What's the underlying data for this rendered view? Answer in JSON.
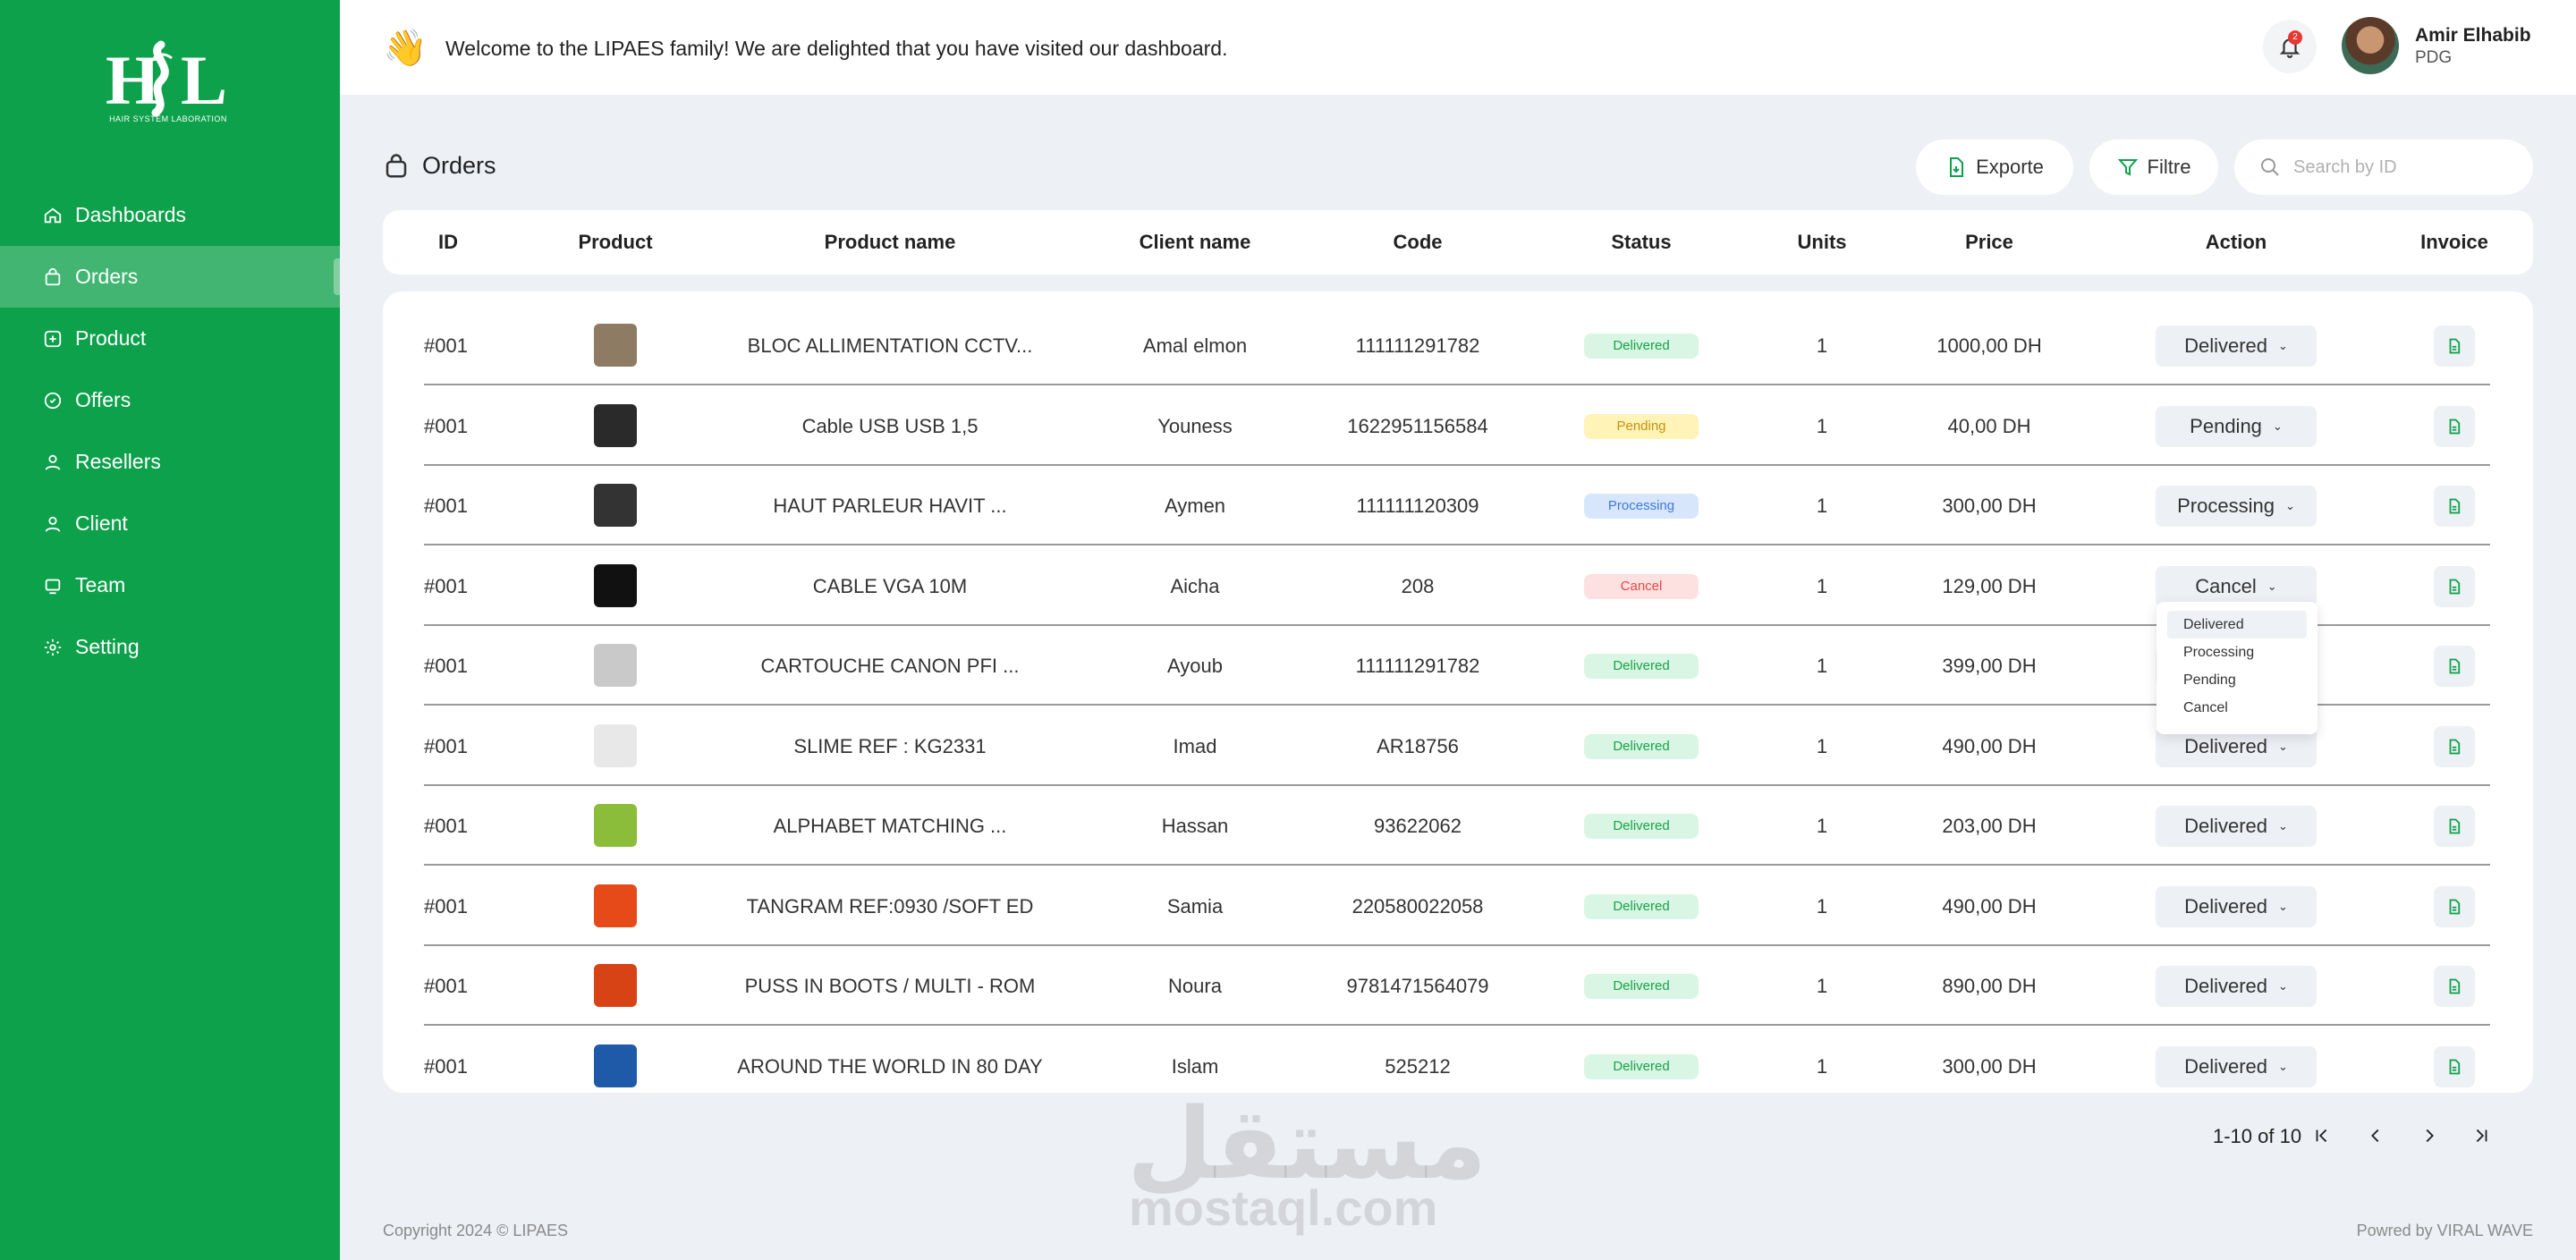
{
  "sidebar": {
    "logo_text": "HSL",
    "logo_subtitle": "HAIR SYSTEM LABORATION",
    "items": [
      {
        "label": "Dashboards",
        "icon": "home-icon"
      },
      {
        "label": "Orders",
        "icon": "bag-icon",
        "active": true
      },
      {
        "label": "Product",
        "icon": "plus-box-icon"
      },
      {
        "label": "Offers",
        "icon": "offer-icon"
      },
      {
        "label": "Resellers",
        "icon": "user-icon"
      },
      {
        "label": "Client",
        "icon": "user-icon"
      },
      {
        "label": "Team",
        "icon": "team-icon"
      },
      {
        "label": "Setting",
        "icon": "gear-icon"
      }
    ]
  },
  "topbar": {
    "welcome": "Welcome to the LIPAES family! We are delighted that you have visited our dashboard.",
    "wave_emoji": "👋",
    "notifications_count": "2",
    "user_name": "Amir Elhabib",
    "user_role": "PDG"
  },
  "page": {
    "title": "Orders",
    "export_label": "Exporte",
    "filter_label": "Filtre",
    "search_placeholder": "Search by ID"
  },
  "table": {
    "headers": [
      "ID",
      "Product",
      "Product name",
      "Client name",
      "Code",
      "Status",
      "Units",
      "Price",
      "Action",
      "Invoice"
    ],
    "rows": [
      {
        "id": "#001",
        "product_name": "BLOC ALLIMENTATION CCTV...",
        "client": "Amal elmon",
        "code": "111111291782",
        "status": "Delivered",
        "units": "1",
        "price": "1000,00 DH",
        "action": "Delivered"
      },
      {
        "id": "#001",
        "product_name": "Cable USB USB 1,5",
        "client": "Youness",
        "code": "1622951156584",
        "status": "Pending",
        "units": "1",
        "price": "40,00 DH",
        "action": "Pending"
      },
      {
        "id": "#001",
        "product_name": "HAUT PARLEUR HAVIT ...",
        "client": "Aymen",
        "code": "111111120309",
        "status": "Processing",
        "units": "1",
        "price": "300,00 DH",
        "action": "Processing"
      },
      {
        "id": "#001",
        "product_name": "CABLE VGA 10M",
        "client": "Aicha",
        "code": "208",
        "status": "Cancel",
        "units": "1",
        "price": "129,00 DH",
        "action": "Cancel"
      },
      {
        "id": "#001",
        "product_name": "CARTOUCHE CANON PFI ...",
        "client": "Ayoub",
        "code": "111111291782",
        "status": "Delivered",
        "units": "1",
        "price": "399,00 DH",
        "action": "Delivered"
      },
      {
        "id": "#001",
        "product_name": "SLIME REF : KG2331",
        "client": "Imad",
        "code": "AR18756",
        "status": "Delivered",
        "units": "1",
        "price": "490,00 DH",
        "action": "Delivered"
      },
      {
        "id": "#001",
        "product_name": "ALPHABET MATCHING ...",
        "client": "Hassan",
        "code": "93622062",
        "status": "Delivered",
        "units": "1",
        "price": "203,00 DH",
        "action": "Delivered"
      },
      {
        "id": "#001",
        "product_name": "TANGRAM REF:0930 /SOFT ED",
        "client": "Samia",
        "code": "220580022058",
        "status": "Delivered",
        "units": "1",
        "price": "490,00 DH",
        "action": "Delivered"
      },
      {
        "id": "#001",
        "product_name": "PUSS IN BOOTS / MULTI - ROM",
        "client": "Noura",
        "code": "9781471564079",
        "status": "Delivered",
        "units": "1",
        "price": "890,00 DH",
        "action": "Delivered"
      },
      {
        "id": "#001",
        "product_name": "AROUND THE WORLD IN 80 DAY",
        "client": "Islam",
        "code": "525212",
        "status": "Delivered",
        "units": "1",
        "price": "300,00 DH",
        "action": "Delivered"
      }
    ]
  },
  "dropdown": {
    "options": [
      "Delivered",
      "Processing",
      "Pending",
      "Cancel"
    ],
    "highlighted": "Delivered"
  },
  "pagination": {
    "text": "1-10 of 10"
  },
  "watermark": {
    "arabic": "مستقل",
    "latin": "mostaql.com"
  },
  "footer": {
    "copyright": "Copyright 2024 © LIPAES",
    "powered": "Powred by VIRAL WAVE"
  },
  "colors": {
    "brand_green": "#0ca14a",
    "page_bg": "#edf0f5"
  }
}
